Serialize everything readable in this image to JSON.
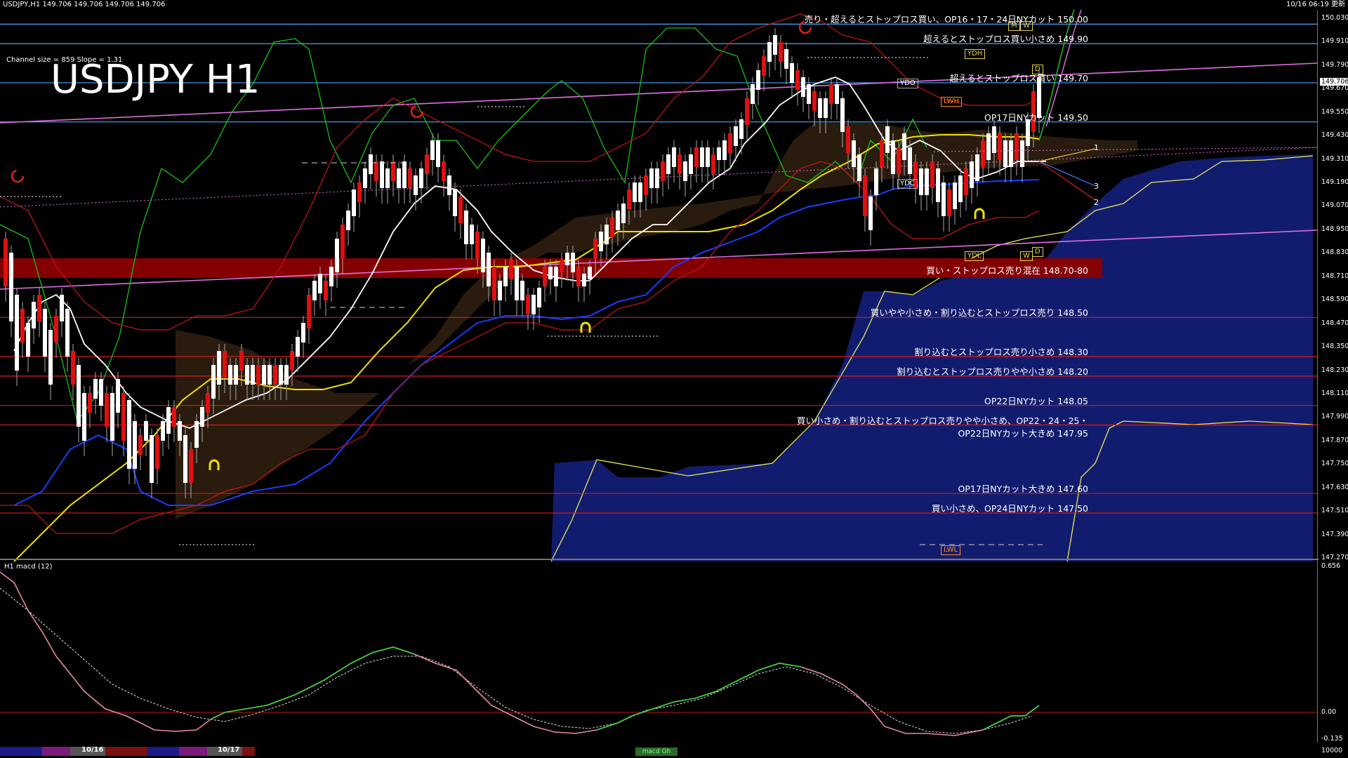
{
  "header": {
    "left": "USDJPY,H1  149.706 149.706 149.706 149.706",
    "right": "10/16 06:19 更新"
  },
  "chart": {
    "title": "USDJPY H1",
    "channel_info": "Channel size = 859 Slope = 1.31",
    "current_price": "149.706"
  },
  "levels": [
    {
      "price": 150.0,
      "label": "売り・超えるとストップロス買い、OP16・17・24日NYカット 150.00",
      "color": "#4aa3ff"
    },
    {
      "price": 149.9,
      "label": "超えるとストップロス買い小さめ 149.90",
      "color": "#4aa3ff"
    },
    {
      "price": 149.7,
      "label": "超えるとストップロス買い 149.70",
      "color": "#4aa3ff"
    },
    {
      "price": 149.5,
      "label": "OP17日NYカット 149.50",
      "color": "#4aa3ff"
    },
    {
      "price": 148.75,
      "label": "買い・ストップロス売り混在 148.70-80",
      "color": "#8b0000"
    },
    {
      "price": 148.5,
      "label": "買いやや小さめ・割り込むとストップロス売り 148.50",
      "color": "#d81a1a"
    },
    {
      "price": 148.3,
      "label": "割り込むとストップロス売り小さめ 148.30",
      "color": "#d81a1a"
    },
    {
      "price": 148.2,
      "label": "割り込むとストップロス売りやや小さめ 148.20",
      "color": "#d81a1a"
    },
    {
      "price": 148.05,
      "label": "OP22日NYカット 148.05",
      "color": "#d81a1a"
    },
    {
      "price": 147.95,
      "label": "買い小さめ・割り込むとストップロス売りやや小さめ、OP22・24・25・",
      "label2": "OP22日NYカット大きめ 147.95",
      "color": "#d81a1a"
    },
    {
      "price": 147.6,
      "label": "OP17日NYカット大きめ 147.60",
      "color": "#d81a1a"
    },
    {
      "price": 147.5,
      "label": "買い小さめ、OP24日NYカット 147.50",
      "color": "#d81a1a"
    }
  ],
  "yaxis": [
    "150.030",
    "149.910",
    "149.790",
    "149.670",
    "149.550",
    "149.430",
    "149.310",
    "149.190",
    "149.070",
    "148.950",
    "148.830",
    "148.710",
    "148.590",
    "148.470",
    "148.350",
    "148.230",
    "148.110",
    "147.990",
    "147.870",
    "147.750",
    "147.630",
    "147.510",
    "147.390",
    "147.270"
  ],
  "markers": {
    "ydh": "YDH",
    "ydo": "YDO",
    "ydc": "YDC",
    "ydl": "YDL",
    "lwh": "LWH",
    "lwl": "LWL",
    "m": "M",
    "w": "W",
    "d": "D",
    "wv": "W",
    "proj1": "1",
    "proj2": "2",
    "proj3": "3"
  },
  "macd": {
    "title": "H1 macd (12)",
    "yaxis": [
      "0.656",
      "0.00",
      "-0.135",
      "10000"
    ]
  },
  "footer": {
    "date1": "10/16",
    "date2": "10/17",
    "macd_tab": "macd Gh"
  },
  "colors": {
    "background": "#000000",
    "resistance": "#4aa3ff",
    "support": "#d81a1a",
    "zone": "#8b0000",
    "channel": "#e070e0",
    "cloud": "#1b2a8a",
    "macd_up": "#39d839",
    "macd_down": "#e58aa8"
  }
}
